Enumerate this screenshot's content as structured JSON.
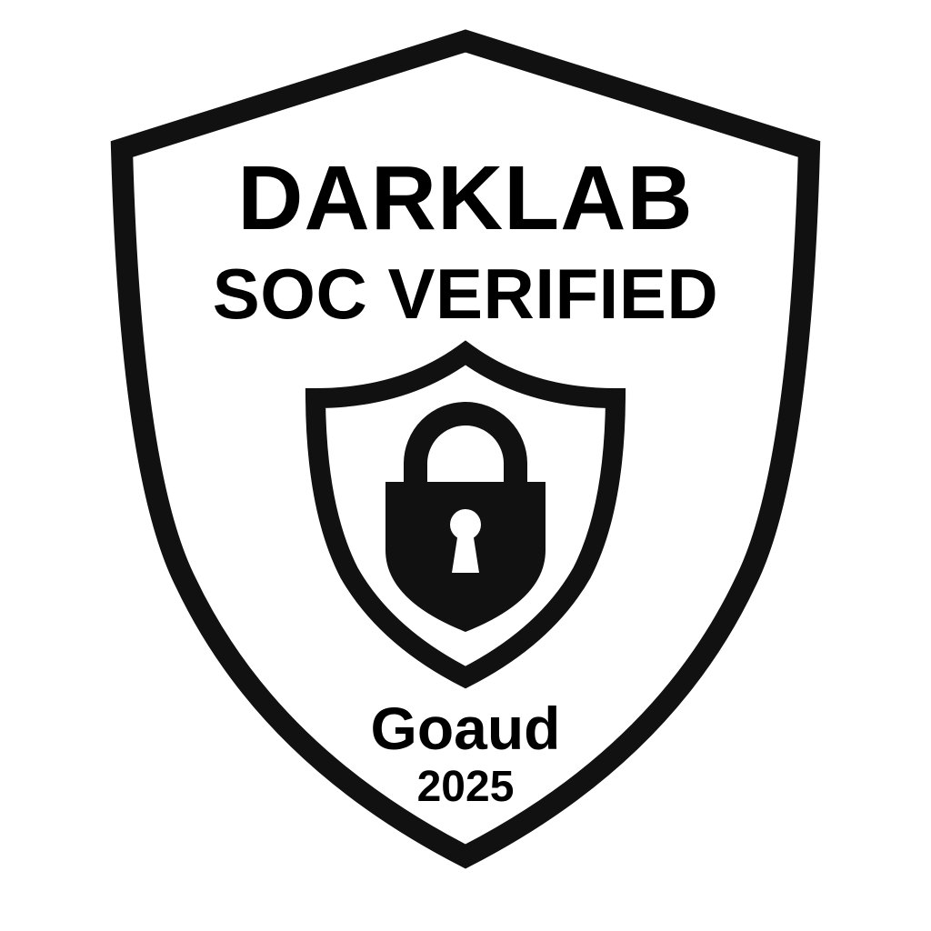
{
  "badge": {
    "title": "DARKLAB",
    "subtitle": "SOC VERIFIED",
    "issuer": "Goaud",
    "year": "2025",
    "icons": {
      "outer": "shield-outline-icon",
      "inner": "shield-outline-icon",
      "center": "padlock-icon"
    },
    "colors": {
      "ink": "#111111",
      "background": "#ffffff"
    }
  }
}
